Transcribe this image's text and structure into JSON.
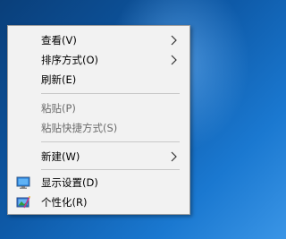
{
  "menu": {
    "items": [
      {
        "label": "查看(V)"
      },
      {
        "label": "排序方式(O)"
      },
      {
        "label": "刷新(E)"
      },
      {
        "label": "粘贴(P)"
      },
      {
        "label": "粘贴快捷方式(S)"
      },
      {
        "label": "新建(W)"
      },
      {
        "label": "显示设置(D)",
        "icon": "display-icon"
      },
      {
        "label": "个性化(R)",
        "icon": "personalize-icon"
      }
    ]
  },
  "colors": {
    "menu_bg": "#f2f2f2",
    "disabled_text": "#6d6d6d",
    "desktop": "#0e5aa8"
  }
}
